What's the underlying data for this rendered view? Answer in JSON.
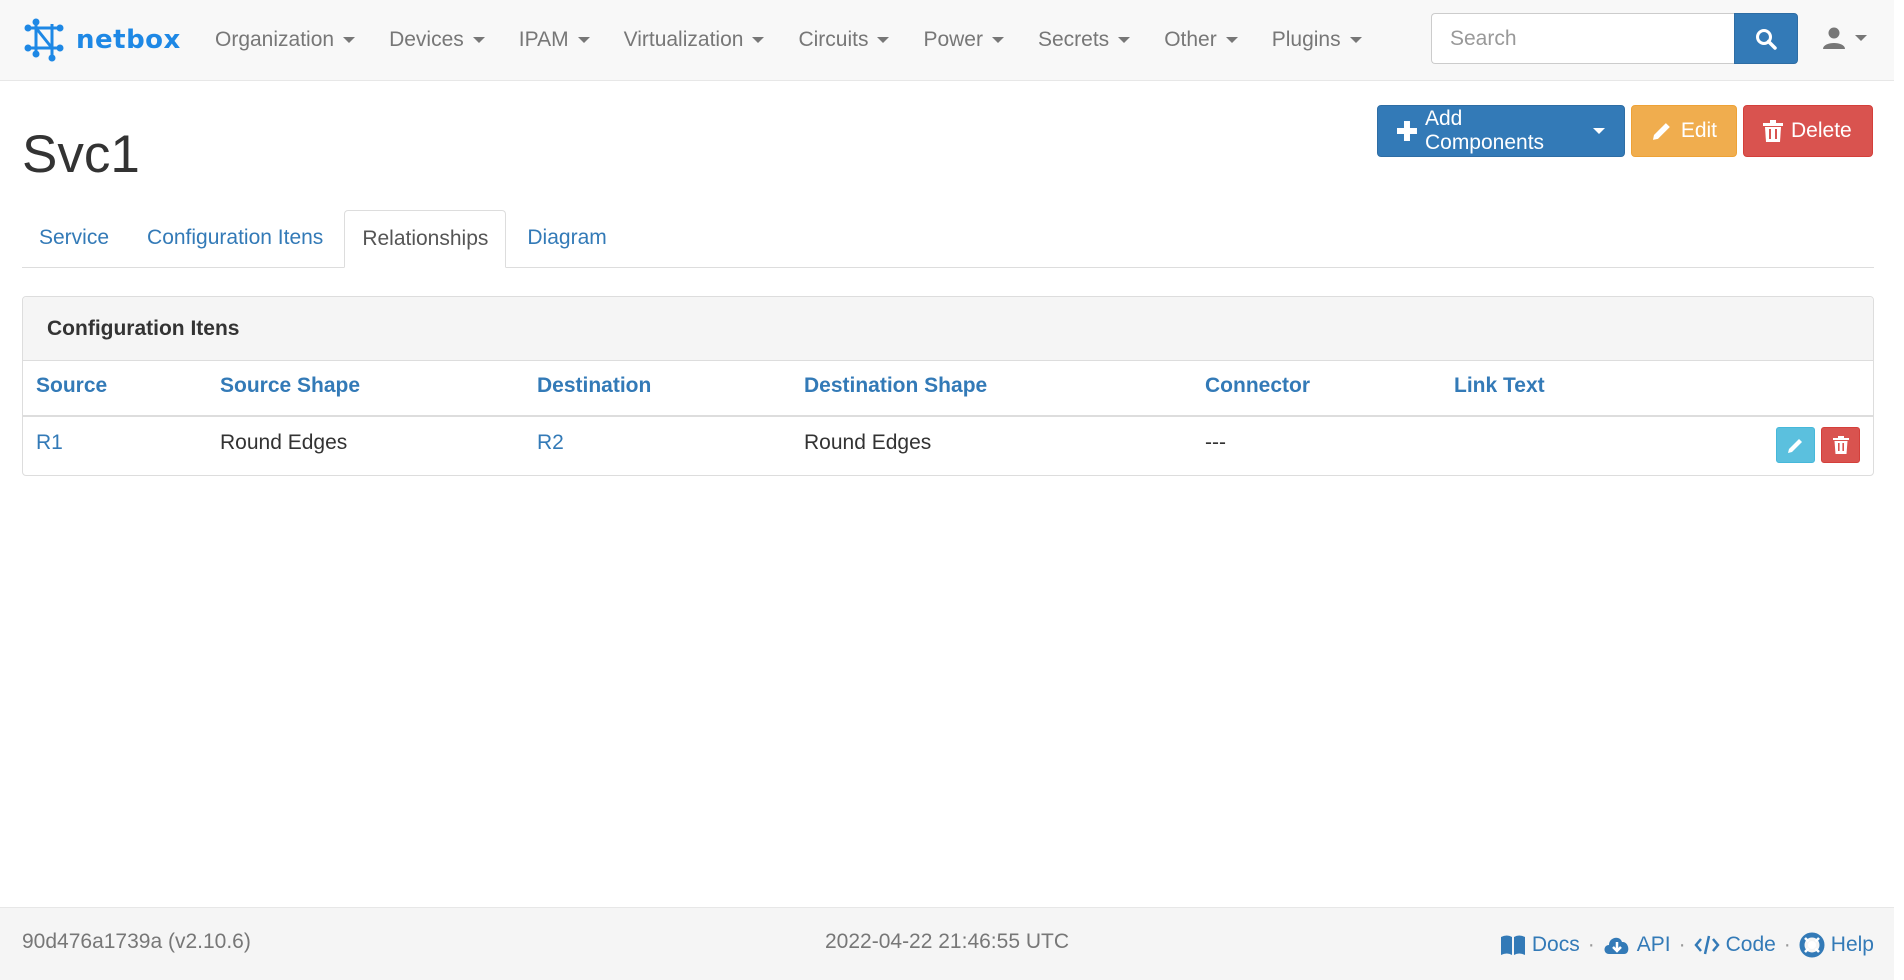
{
  "brand": {
    "name": "netbox"
  },
  "nav": [
    {
      "label": "Organization"
    },
    {
      "label": "Devices"
    },
    {
      "label": "IPAM"
    },
    {
      "label": "Virtualization"
    },
    {
      "label": "Circuits"
    },
    {
      "label": "Power"
    },
    {
      "label": "Secrets"
    },
    {
      "label": "Other"
    },
    {
      "label": "Plugins"
    }
  ],
  "search": {
    "placeholder": "Search",
    "value": ""
  },
  "page": {
    "title": "Svc1"
  },
  "actions": {
    "add": "Add Components",
    "edit": "Edit",
    "delete": "Delete"
  },
  "tabs": [
    {
      "label": "Service",
      "active": false
    },
    {
      "label": "Configuration Itens",
      "active": false
    },
    {
      "label": "Relationships",
      "active": true
    },
    {
      "label": "Diagram",
      "active": false
    }
  ],
  "panel": {
    "title": "Configuration Itens",
    "columns": [
      "Source",
      "Source Shape",
      "Destination",
      "Destination Shape",
      "Connector",
      "Link Text"
    ],
    "rows": [
      {
        "source": "R1",
        "source_shape": "Round Edges",
        "destination": "R2",
        "destination_shape": "Round Edges",
        "connector": "---",
        "link_text": ""
      }
    ]
  },
  "footer": {
    "version": "90d476a1739a (v2.10.6)",
    "timestamp": "2022-04-22 21:46:55 UTC",
    "links": {
      "docs": "Docs",
      "api": "API",
      "code": "Code",
      "help": "Help"
    },
    "separator": "·"
  },
  "colors": {
    "primary": "#337ab7",
    "warning": "#f0ad4e",
    "danger": "#d9534f",
    "info": "#5bc0de",
    "brand": "#1e88e5"
  },
  "icons": [
    "netbox-logo-icon",
    "search-icon",
    "user-icon",
    "plus-icon",
    "pencil-icon",
    "trash-icon",
    "book-icon",
    "cloud-download-icon",
    "code-icon",
    "lifebuoy-icon"
  ]
}
